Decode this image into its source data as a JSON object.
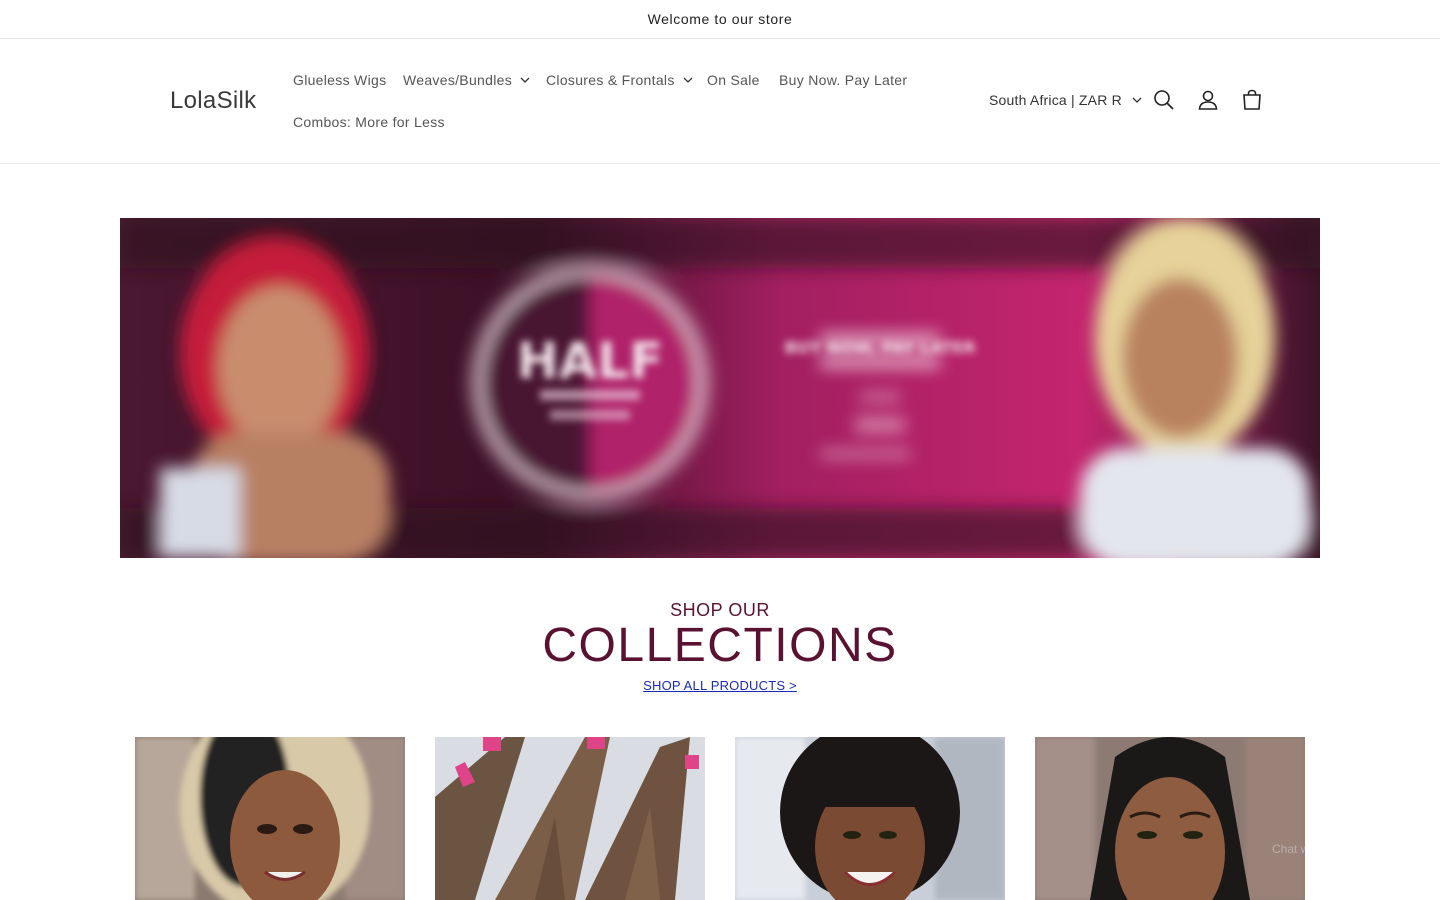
{
  "announcement": {
    "text": "Welcome to our store"
  },
  "header": {
    "logo": "LolaSilk",
    "nav": [
      {
        "label": "Glueless Wigs"
      },
      {
        "label": "Weaves/Bundles"
      },
      {
        "label": "Closures & Frontals"
      },
      {
        "label": "On Sale"
      },
      {
        "label": "Buy Now. Pay Later"
      },
      {
        "label": "Combos: More for Less"
      }
    ],
    "country": "South Africa | ZAR R",
    "icons": [
      "search-icon",
      "account-icon",
      "cart-icon"
    ]
  },
  "banner": {
    "headline": "HALF",
    "tagline": "BUY NOW, PAY LATER"
  },
  "collections": {
    "eyebrow": "SHOP OUR",
    "title": "COLLECTIONS",
    "link": "SHOP ALL PRODUCTS >"
  },
  "colors": {
    "brand": "#5a1233",
    "link": "#1b2bb5",
    "banner_pink": "#b8246a"
  },
  "chat": {
    "label": "Chat with us"
  }
}
